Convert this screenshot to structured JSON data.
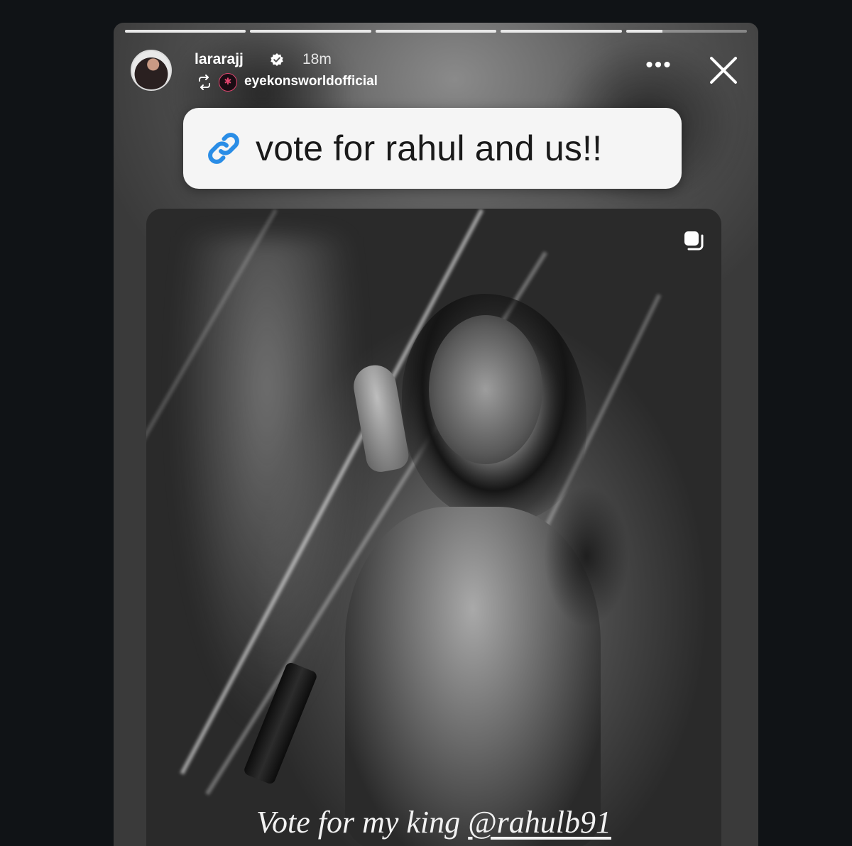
{
  "story": {
    "progress": [
      1,
      1,
      1,
      1,
      0.3
    ],
    "header": {
      "username": "lararajj",
      "verified_icon": "verified-badge-icon",
      "time": "18m",
      "repost_icon": "repost-icon",
      "source_account": "eyekonsworldofficial",
      "more_icon": "more-icon",
      "close_icon": "close-icon"
    },
    "link_sticker": {
      "icon": "link-icon",
      "text": "vote for rahul and us!!",
      "icon_color": "#2a8de6"
    },
    "post": {
      "carousel_icon": "carousel-icon",
      "caption_prefix": "Vote for my king",
      "caption_mention": "@rahulb91"
    }
  }
}
